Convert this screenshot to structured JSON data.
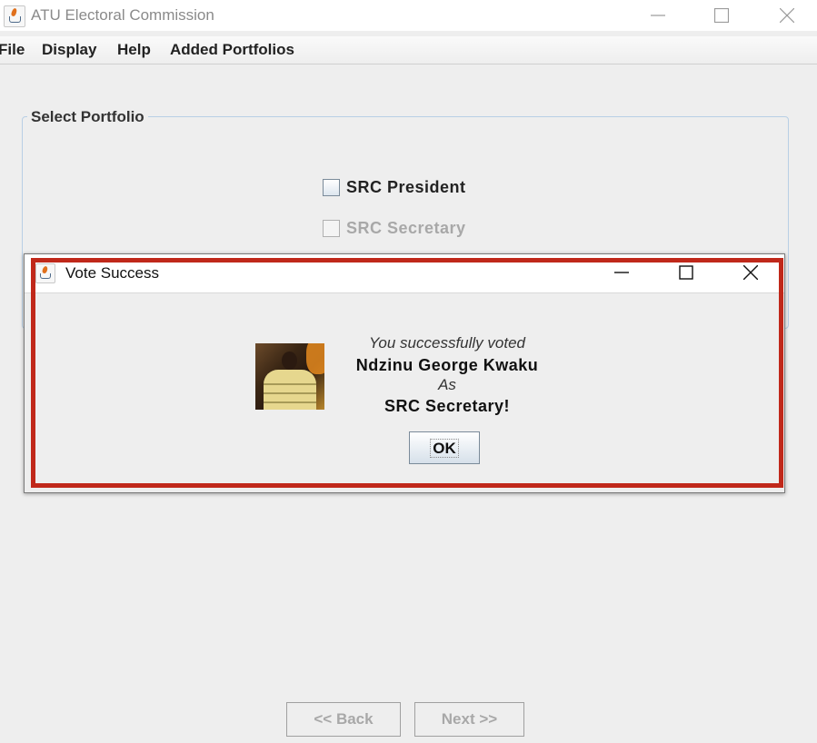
{
  "window": {
    "title": "ATU Electoral Commission"
  },
  "menu": [
    {
      "label": "File"
    },
    {
      "label": "Display"
    },
    {
      "label": "Help"
    },
    {
      "label": "Added Portfolios"
    }
  ],
  "portfolio_group": {
    "title": "Select Portfolio",
    "options": [
      {
        "label": "SRC President",
        "checked": false,
        "enabled": true
      },
      {
        "label": "SRC Secretary",
        "checked": false,
        "enabled": false
      }
    ]
  },
  "navigation": {
    "back_label": "<< Back",
    "next_label": "Next >>"
  },
  "dialog": {
    "title": "Vote Success",
    "line1": "You successfully voted",
    "candidate": "Ndzinu George Kwaku",
    "line3": "As",
    "portfolio": "SRC Secretary!",
    "ok_label": "OK"
  },
  "colors": {
    "highlight": "#c0281a",
    "group_border": "#b8cfe5",
    "disabled_text": "#a8a8a8"
  }
}
